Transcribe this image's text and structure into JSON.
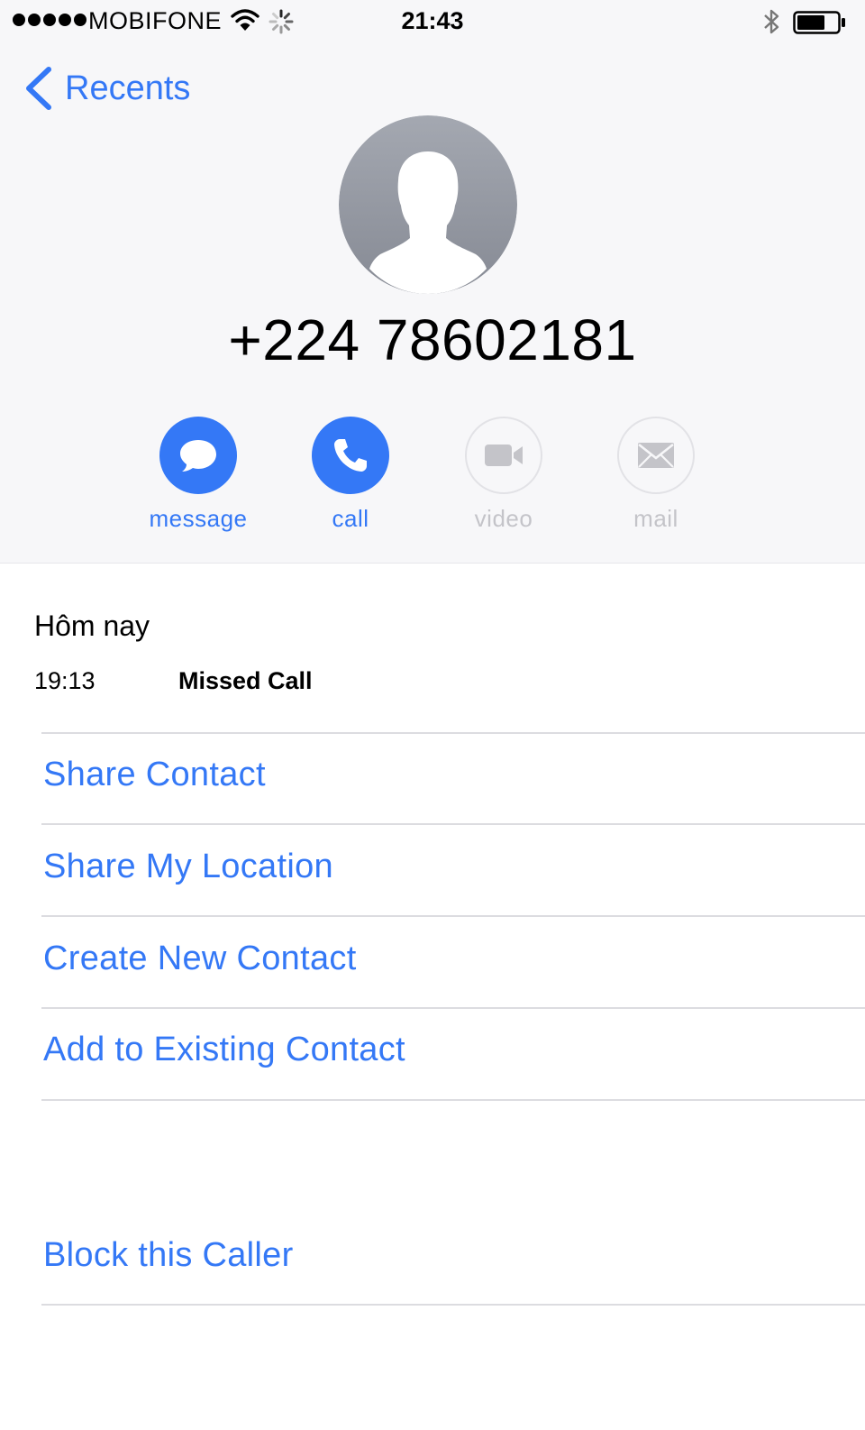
{
  "status_bar": {
    "carrier": "MOBIFONE",
    "time": "21:43"
  },
  "nav": {
    "back_label": "Recents"
  },
  "contact": {
    "phone_number": "+224 78602181"
  },
  "actions": [
    {
      "label": "message",
      "enabled": true,
      "icon": "message-bubble-icon"
    },
    {
      "label": "call",
      "enabled": true,
      "icon": "phone-icon"
    },
    {
      "label": "video",
      "enabled": false,
      "icon": "video-camera-icon"
    },
    {
      "label": "mail",
      "enabled": false,
      "icon": "envelope-icon"
    }
  ],
  "history": {
    "date": "Hôm nay",
    "time": "19:13",
    "type": "Missed Call"
  },
  "options": [
    "Share Contact",
    "Share My Location",
    "Create New Contact",
    "Add to Existing Contact"
  ],
  "block": {
    "label": "Block this Caller"
  },
  "colors": {
    "accent": "#3478f6",
    "disabled": "#c4c4c9",
    "header_bg": "#f7f7f9"
  }
}
